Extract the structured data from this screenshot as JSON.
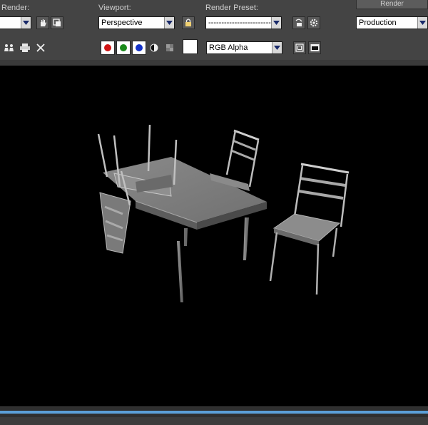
{
  "row1": {
    "render_label": "Render:",
    "viewport_label": "Viewport:",
    "viewport_value": "Perspective",
    "preset_label": "Render Preset:",
    "preset_value": "--------------------------",
    "render_button": "Render",
    "mode_value": "Production"
  },
  "row2": {
    "channel_value": "RGB Alpha"
  },
  "colors": {
    "red_channel": "#d01414",
    "green_channel": "#1a8a1a",
    "blue_channel": "#1432c8",
    "progress": "#5b9fd8"
  },
  "progress": {
    "fraction": 1.0
  },
  "icons": [
    "dropdown-arrow-icon",
    "hand-icon",
    "copy-icon",
    "lock-icon",
    "save-preset-icon",
    "gear-icon",
    "people-icon",
    "printer-icon",
    "close-icon",
    "contrast-icon",
    "checker-icon",
    "white-swatch-icon",
    "frame-icon",
    "display-icon"
  ]
}
